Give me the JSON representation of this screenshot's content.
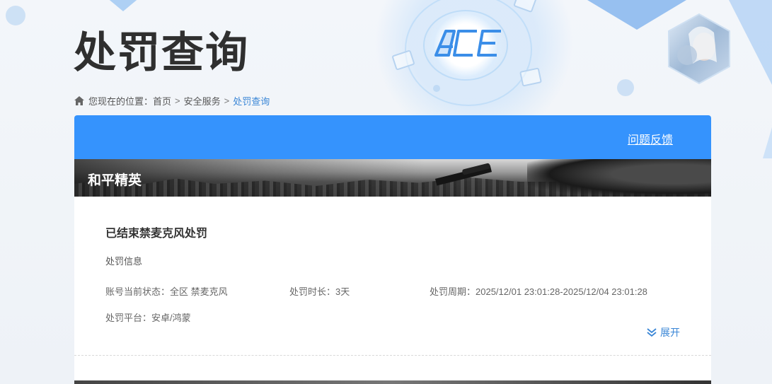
{
  "page": {
    "title": "处罚查询"
  },
  "breadcrumb": {
    "prefix": "您现在的位置：",
    "items": [
      "首页",
      "安全服务",
      "处罚查询"
    ],
    "separator": ">"
  },
  "panel": {
    "feedback_link": "问题反馈",
    "game_name": "和平精英"
  },
  "record": {
    "title": "已结束禁麦克风处罚",
    "section_label": "处罚信息",
    "fields": {
      "status_label": "账号当前状态：",
      "status_value": "全区 禁麦克风",
      "duration_label": "处罚时长：",
      "duration_value": "3天",
      "period_label": "处罚周期：",
      "period_value": "2025/12/01 23:01:28-2025/12/04 23:01:28",
      "platform_label": "处罚平台：",
      "platform_value": "安卓/鸿蒙"
    },
    "expand_label": "展开"
  },
  "colors": {
    "header_blue": "#3593fd",
    "link_blue": "#3a86d6"
  },
  "icons": {
    "home": "home-icon",
    "expand": "double-chevron-down-icon",
    "logo": "ace-logo"
  }
}
